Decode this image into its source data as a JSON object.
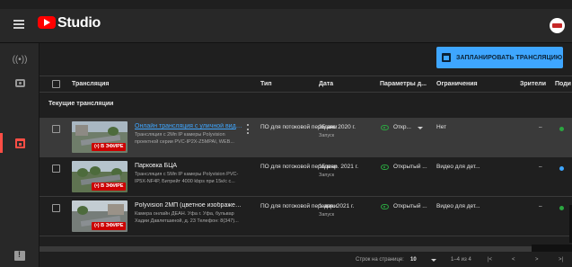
{
  "app": {
    "name": "Studio",
    "logo_icon": "youtube-logo-icon"
  },
  "sidebar": {
    "items": [
      {
        "icon": "live-broadcast-icon",
        "glyph": "((•))"
      },
      {
        "icon": "camera-icon"
      },
      {
        "icon": "calendar-icon",
        "active": true
      },
      {
        "icon": "feedback-icon"
      }
    ]
  },
  "toolbar": {
    "schedule_label": "ЗАПЛАНИРОВАТЬ ТРАНСЛЯЦИЮ"
  },
  "table": {
    "headers": {
      "broadcast": "Трансляция",
      "type": "Тип",
      "date": "Дата",
      "params": "Параметры д...",
      "restrictions": "Ограничения",
      "viewers": "Зрители",
      "extra": "Поди"
    },
    "section_title": "Текущие трансляции",
    "rows": [
      {
        "title": "Онлайн трансляция с уличной виде...",
        "description": "Трансляция с 2Мп IP камеры Polyvision проектной серии PVC-IP2X-Z5MPAI, WEB...",
        "badge": "В ЭФИРЕ",
        "type": "ПО для потоковой передачи",
        "date": "25 авг. 2020 г.",
        "date_sub": "Запуск",
        "visibility": "Откр...",
        "restrictions": "Нет",
        "viewers": "–",
        "status_color": "#2ba640"
      },
      {
        "title": "Парковка БЦА",
        "description": "Трансляция с 5Mп IP камеры Polyvision PVC-IP5X-NF4P, Битрейт 4000 kbps при 15к/с с...",
        "badge": "В ЭФИРЕ",
        "type": "ПО для потоковой передачи",
        "date": "15 мар. 2021 г.",
        "date_sub": "Запуск",
        "visibility": "Открытый ...",
        "restrictions": "Видео для дет...",
        "viewers": "–",
        "status_color": "#3ea6ff"
      },
      {
        "title": "Polyvision 2МП (цветное изображен...",
        "description": "Камера онлайн ДЕАН. Уфа г. Уфа, бульвар Хадии Давлетшиной, д. 23 Телефон: 8(347)...",
        "badge": "В ЭФИРЕ",
        "type": "ПО для потоковой передачи",
        "date": "1 апр. 2021 г.",
        "date_sub": "Запуск",
        "visibility": "Открытый ...",
        "restrictions": "Видео для дет...",
        "viewers": "–",
        "status_color": "#2ba640"
      }
    ]
  },
  "pagination": {
    "rows_per_page_label": "Строк на странице:",
    "rows_per_page": "10",
    "range": "1–4 из 4",
    "first_icon": "|<",
    "prev_icon": "<",
    "next_icon": ">",
    "last_icon": ">|"
  }
}
